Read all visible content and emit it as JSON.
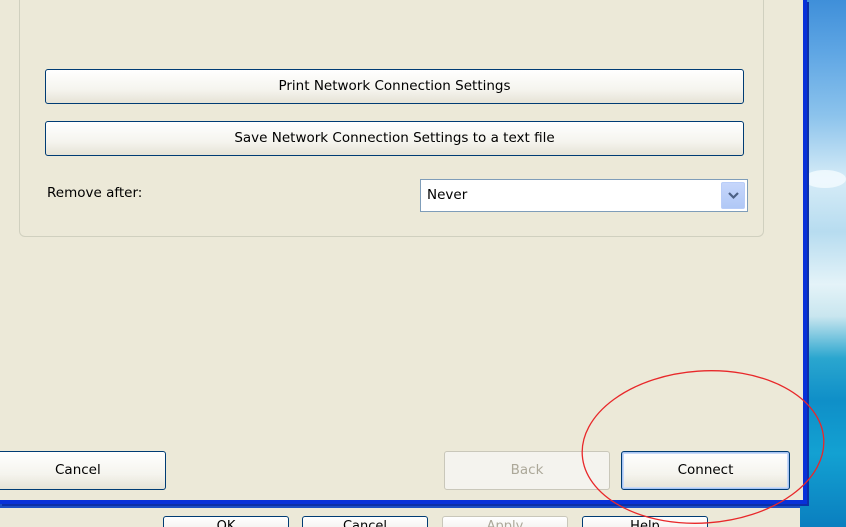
{
  "wizard": {
    "print_button": "Print Network Connection Settings",
    "save_button": "Save Network Connection Settings to a text file",
    "remove_after_label": "Remove after:",
    "remove_after_value": "Never",
    "cancel_button": "Cancel",
    "back_button": "Back",
    "connect_button": "Connect"
  },
  "parent_dialog": {
    "ok_button": "OK",
    "cancel_button": "Cancel",
    "apply_button": "Apply",
    "help_button": "Help"
  },
  "annotation": {
    "color": "#e8282a"
  },
  "icons": {
    "dropdown": "chevron-down-icon"
  }
}
